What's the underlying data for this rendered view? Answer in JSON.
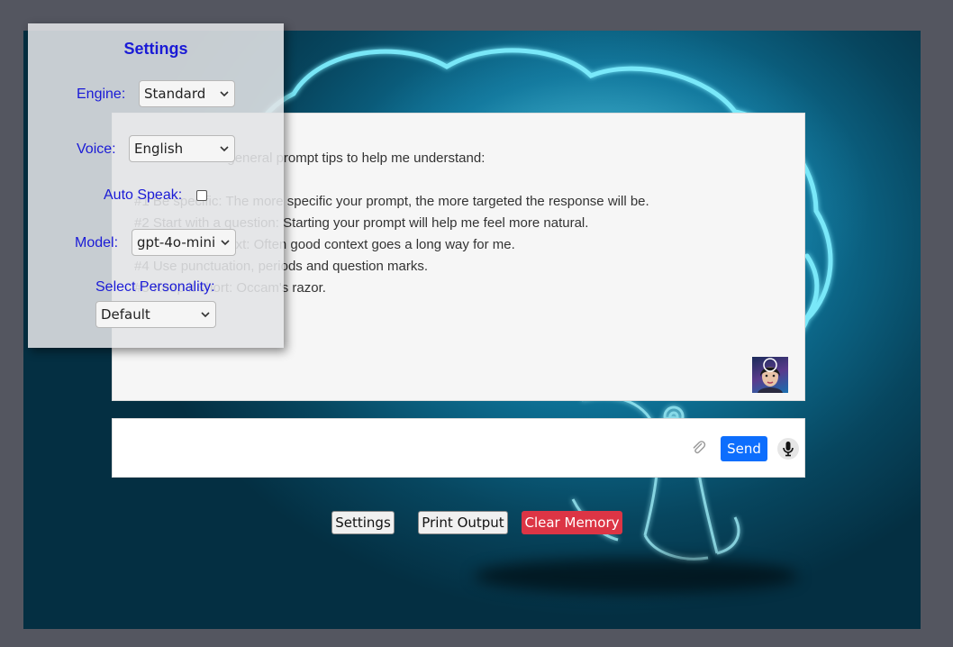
{
  "output": {
    "lines": [
      "Here are some general prompt tips to help me understand:",
      "",
      "#1 Be specific: The more specific your prompt, the more targeted the response will be.",
      "#2 Start with a question: Starting your prompt will help me feel more natural.",
      "#3 Provide context: Often good context goes a long way for me.",
      "#4 Use punctuation, periods and question marks.",
      "#5 Keep it short: Occam's razor."
    ]
  },
  "input": {
    "placeholder": "",
    "send_label": "Send",
    "attach_icon": "paperclip-icon",
    "mic_icon": "microphone-icon"
  },
  "buttons": {
    "settings": "Settings",
    "print_output": "Print Output",
    "clear_memory": "Clear Memory"
  },
  "settings": {
    "title": "Settings",
    "engine_label": "Engine:",
    "engine_value": "Standard",
    "voice_label": "Voice:",
    "voice_value": "English",
    "autospeak_label": "Auto Speak:",
    "autospeak_checked": false,
    "model_label": "Model:",
    "model_value": "gpt-4o-mini",
    "personality_label": "Select Personality:",
    "personality_value": "Default"
  },
  "colors": {
    "settings_text": "#1a1ad6",
    "send_button": "#0d6efd",
    "clear_button": "#dc3545"
  }
}
